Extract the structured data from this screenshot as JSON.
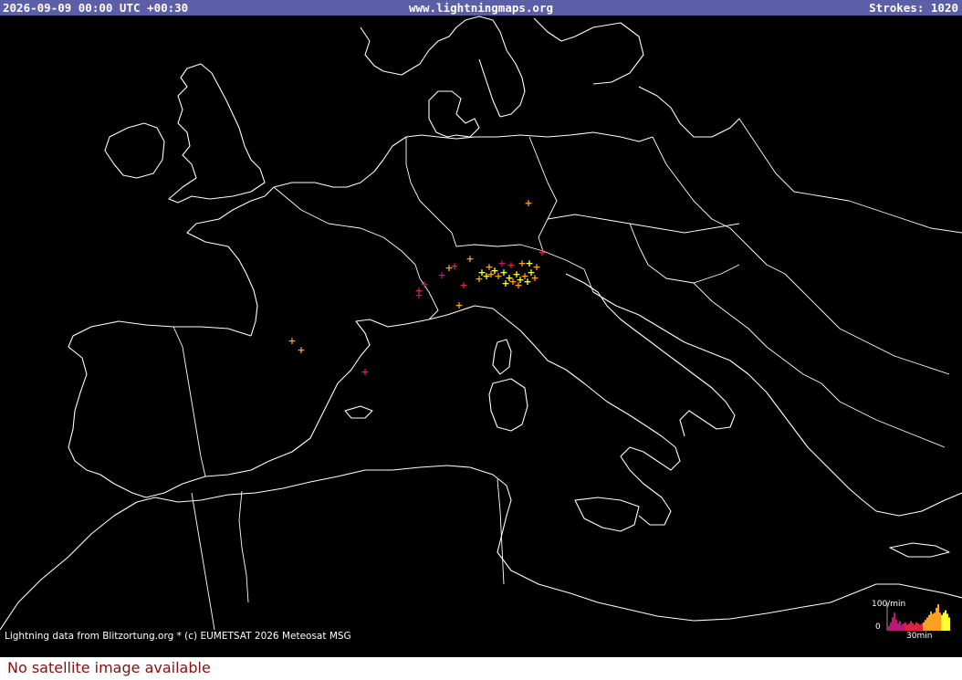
{
  "header": {
    "timestamp": "2026-09-09 00:00 UTC +00:30",
    "site": "www.lightningmaps.org",
    "strokes": "Strokes: 1020"
  },
  "credit": "Lightning data from Blitzortung.org  *  (c) EUMETSAT 2026 Meteosat MSG",
  "footer": "No satellite image available",
  "histogram": {
    "max_label": "100/min",
    "min_label": "0",
    "span_label": "30min",
    "rates_per_min": [
      8,
      14,
      22,
      30,
      18,
      12,
      16,
      10,
      12,
      14,
      10,
      12,
      16,
      12,
      10,
      14,
      12,
      10,
      12,
      14,
      18,
      22,
      26,
      32,
      28,
      30,
      38,
      44,
      30,
      26,
      30,
      34,
      28,
      22
    ],
    "colors": {
      "old": "#c0147a",
      "mid": "#e0203c",
      "recent": "#ffa020",
      "newest": "#ffff30"
    }
  },
  "strokes_legend": {
    "yellow": "#ffff30",
    "orange": "#ffa020",
    "red": "#e0203c",
    "magenta": "#c0147a"
  }
}
